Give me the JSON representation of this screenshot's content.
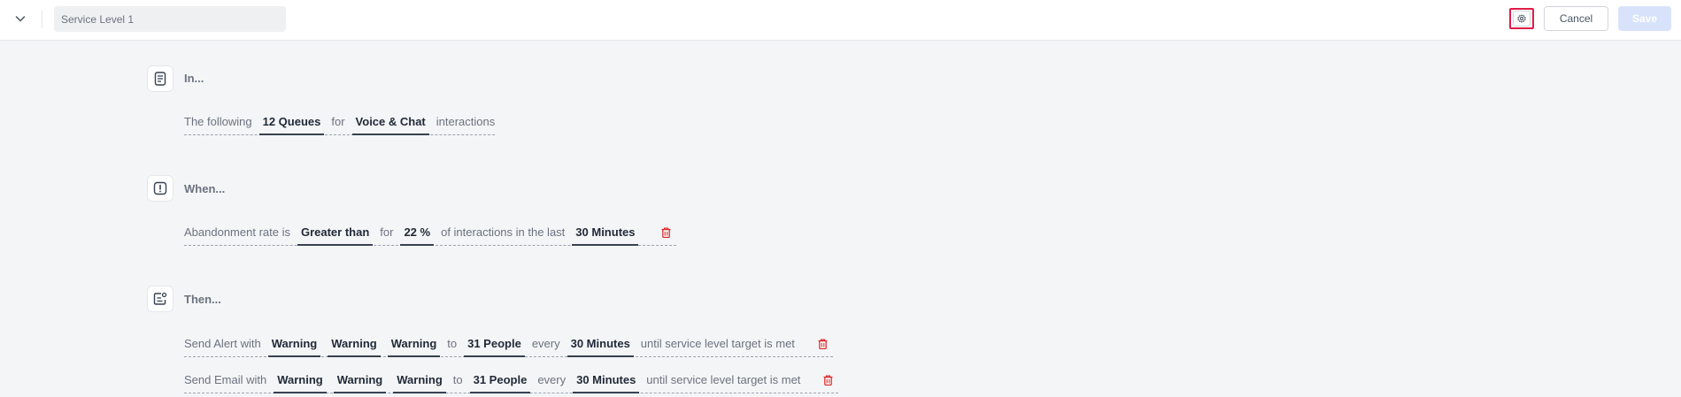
{
  "header": {
    "title_value": "Service Level 1",
    "cancel_label": "Cancel",
    "save_label": "Save"
  },
  "colors": {
    "accent_red": "#e11d48",
    "save_disabled": "#d8e3fb",
    "trash": "#dc2626"
  },
  "sections": {
    "in": {
      "title": "In...",
      "prefix": "The following",
      "queues": "12 Queues",
      "for": "for",
      "channels": "Voice & Chat",
      "suffix": "interactions"
    },
    "when": {
      "title": "When...",
      "metric": "Abandonment rate is",
      "comparator": "Greater than",
      "for": "for",
      "percent": "22 %",
      "of_text": "of interactions in the last",
      "window": "30 Minutes"
    },
    "then": {
      "title": "Then...",
      "rows": [
        {
          "prefix": "Send Alert with",
          "level1": "Warning",
          "level2": "Warning",
          "level3": "Warning",
          "to": "to",
          "people": "31 People",
          "every": "every",
          "interval": "30 Minutes",
          "suffix": "until service level target is met"
        },
        {
          "prefix": "Send Email with",
          "level1": "Warning",
          "level2": "Warning",
          "level3": "Warning",
          "to": "to",
          "people": "31 People",
          "every": "every",
          "interval": "30 Minutes",
          "suffix": "until service level target is met"
        }
      ]
    }
  },
  "icons": {
    "collapse": "chevron-down-icon",
    "settings": "gear-icon",
    "in": "document-icon",
    "when": "alert-square-icon",
    "then": "action-list-icon",
    "delete": "trash-icon"
  }
}
